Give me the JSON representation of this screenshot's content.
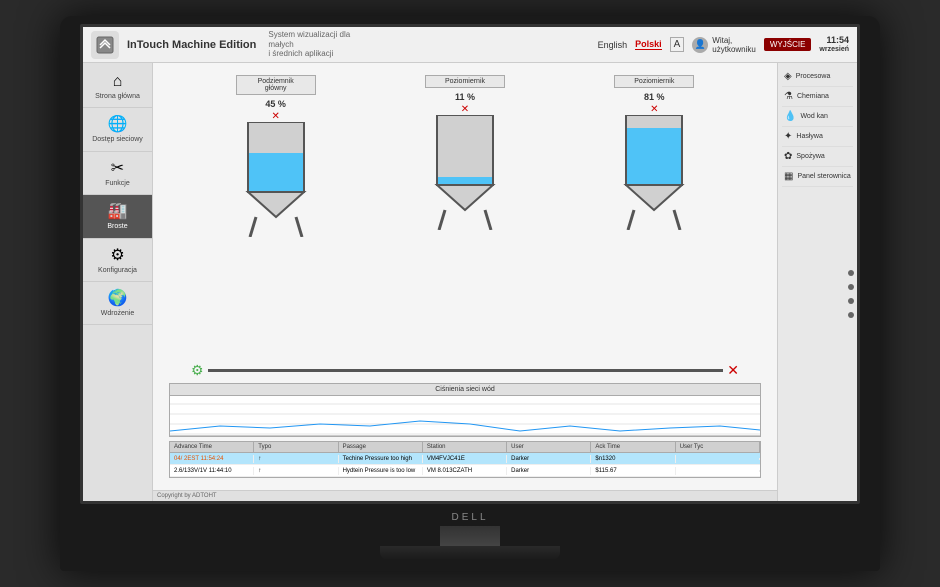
{
  "monitor": {
    "brand": "DELL"
  },
  "header": {
    "app_name": "InTouch",
    "title": "Machine Edition",
    "subtitle_line1": "System wizualizacji dla małych",
    "subtitle_line2": "i średnich aplikacji",
    "nav": {
      "lang1": "English",
      "lang2": "Polski",
      "lang_icon": "A"
    },
    "user": {
      "label": "Witaj,",
      "username": "użytkowniku"
    },
    "login_btn": "WYJŚCIE",
    "time": "11:54",
    "date": "wrzesień"
  },
  "sidebar_left": {
    "items": [
      {
        "label": "Strona główna",
        "icon": "⌂",
        "active": false
      },
      {
        "label": "Dostęp sieciowy",
        "icon": "🌐",
        "active": false
      },
      {
        "label": "Funkcje",
        "icon": "⚙",
        "active": false
      },
      {
        "label": "Broste",
        "icon": "🏭",
        "active": true
      },
      {
        "label": "Konfiguracja",
        "icon": "⚙",
        "active": false
      },
      {
        "label": "Wdrożenie",
        "icon": "🌍",
        "active": false
      }
    ]
  },
  "sidebar_right": {
    "items": [
      {
        "label": "Procesowa",
        "icon": "◈"
      },
      {
        "label": "Chemiana",
        "icon": "⚗"
      },
      {
        "label": "Wod kan",
        "icon": "💧"
      },
      {
        "label": "Hasływa",
        "icon": "✦"
      },
      {
        "label": "Spożywa",
        "icon": "✿"
      },
      {
        "label": "Panel sterownica",
        "icon": "▦"
      }
    ]
  },
  "tanks": [
    {
      "label_line1": "Podziemnik",
      "label_line2": "główny",
      "percent": "45 %",
      "fill_height": 40
    },
    {
      "label_line1": "Poziomiernik",
      "label_line2": "",
      "percent": "11 %",
      "fill_height": 10
    },
    {
      "label_line1": "Poziomiernik",
      "label_line2": "",
      "percent": "81 %",
      "fill_height": 73
    }
  ],
  "chart": {
    "title": "Ciśnienia sieci wód"
  },
  "alarm_table": {
    "columns": [
      "Advance Time",
      "Typo",
      "Passage",
      "Station",
      "User",
      "Ack Time",
      "User Tyc"
    ],
    "rows": [
      {
        "time": "04/ 2EST 11:54:24",
        "type": "↑",
        "passage": "Techine Pressure too high",
        "station": "VM4FVJC41E",
        "user": "Darker",
        "ack_time": "$n1320",
        "user_tyc": "",
        "selected": true,
        "warn": true
      },
      {
        "time": "2.6/133V/1V 11:44:10",
        "type": "↑",
        "passage": "Hydtein Pressure is too low",
        "station": "VM 8.013CZATH",
        "user": "Darker",
        "ack_time": "$115.67",
        "user_tyc": "",
        "selected": false,
        "warn": false
      }
    ]
  },
  "copyright": "Copyright by ADTOHT"
}
